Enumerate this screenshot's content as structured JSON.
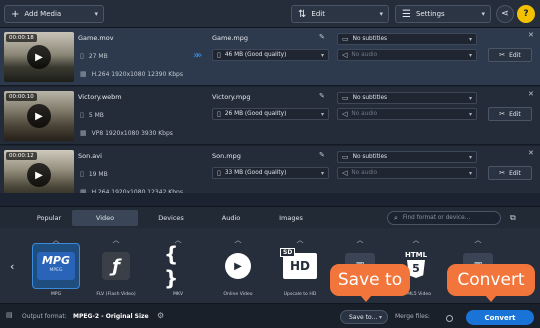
{
  "toolbar": {
    "add_media": "Add Media",
    "edit": "Edit",
    "settings": "Settings"
  },
  "files": [
    {
      "timecode": "00:00:18",
      "name": "Game.mov",
      "size": "27 MB",
      "codec": "H.264 1920x1080 12390 Kbps",
      "output_name": "Game.mpg",
      "output_size": "46 MB (Good quality)",
      "subtitles": "No subtitles",
      "audio": "No audio",
      "edit_label": "Edit",
      "selected": true
    },
    {
      "timecode": "00:00:10",
      "name": "Victory.webm",
      "size": "5 MB",
      "codec": "VP8 1920x1080 3930 Kbps",
      "output_name": "Victory.mpg",
      "output_size": "26 MB (Good quality)",
      "subtitles": "No subtitles",
      "audio": "No audio",
      "edit_label": "Edit",
      "selected": false
    },
    {
      "timecode": "00:00:12",
      "name": "Son.avi",
      "size": "19 MB",
      "codec": "H.264 1920x1080 12342 Kbps",
      "output_name": "Son.mpg",
      "output_size": "33 MB (Good quality)",
      "subtitles": "No subtitles",
      "audio": "No audio",
      "edit_label": "Edit",
      "selected": false
    }
  ],
  "tabs": [
    "Popular",
    "Video",
    "Devices",
    "Audio",
    "Images"
  ],
  "active_tab": "Video",
  "search": {
    "placeholder": "Find format or device..."
  },
  "formats": [
    {
      "label": "MPG",
      "icon": "mpg-icon"
    },
    {
      "label": "FLV (Flash Video)",
      "icon": "flash-icon"
    },
    {
      "label": "MKV",
      "icon": "mkv-icon"
    },
    {
      "label": "Online Video",
      "icon": "youtube-icon"
    },
    {
      "label": "Upscale to HD",
      "icon": "hd-icon"
    },
    {
      "label": "",
      "icon": "format-icon"
    },
    {
      "label": "HTML5 Video",
      "icon": "html5-icon"
    },
    {
      "label": "",
      "icon": "format-icon"
    }
  ],
  "mpg_badge": {
    "main": "MPG",
    "sub": "MPEG"
  },
  "html5_badge": {
    "top": "HTML",
    "num": "5"
  },
  "hd_badge": {
    "sd": "SD",
    "hd": "HD"
  },
  "status": {
    "output_format_label": "Output format:",
    "output_format_value": "MPEG-2 - Original Size",
    "save_to": "Save to...",
    "merge_files": "Merge files:",
    "convert": "Convert"
  },
  "callouts": {
    "save_to": "Save to",
    "convert": "Convert"
  },
  "colors": {
    "accent": "#1a73d6",
    "callout": "#f2763c",
    "help": "#f2c200"
  }
}
